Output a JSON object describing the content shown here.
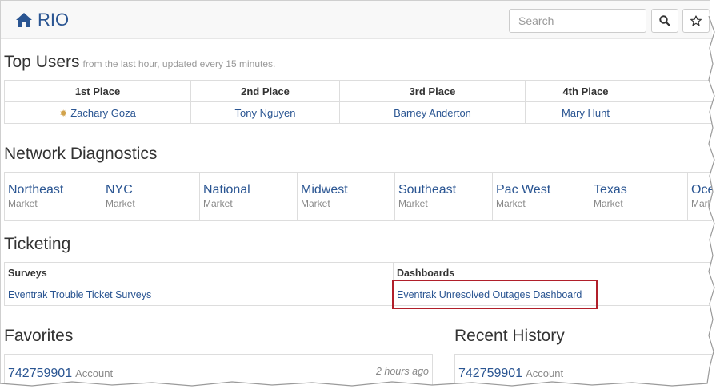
{
  "navbar": {
    "brand": "RIO",
    "search_placeholder": "Search"
  },
  "top_users": {
    "title": "Top Users",
    "subtitle": "from the last hour, updated every 15 minutes.",
    "columns": [
      "1st Place",
      "2nd Place",
      "3rd Place",
      "4th Place"
    ],
    "users": [
      "Zachary Goza",
      "Tony Nguyen",
      "Barney Anderton",
      "Mary Hunt"
    ]
  },
  "network_diagnostics": {
    "title": "Network Diagnostics",
    "markets": [
      {
        "name": "Northeast",
        "type": "Market"
      },
      {
        "name": "NYC",
        "type": "Market"
      },
      {
        "name": "National",
        "type": "Market"
      },
      {
        "name": "Midwest",
        "type": "Market"
      },
      {
        "name": "Southeast",
        "type": "Market"
      },
      {
        "name": "Pac West",
        "type": "Market"
      },
      {
        "name": "Texas",
        "type": "Market"
      },
      {
        "name": "Oce",
        "type": "Mark"
      }
    ]
  },
  "ticketing": {
    "title": "Ticketing",
    "surveys_header": "Surveys",
    "dashboards_header": "Dashboards",
    "survey_link": "Eventrak Trouble Ticket Surveys",
    "dashboard_link": "Eventrak Unresolved Outages Dashboard"
  },
  "favorites": {
    "title": "Favorites",
    "entry_value": "742759901",
    "entry_type": "Account",
    "entry_time": "2 hours ago"
  },
  "recent_history": {
    "title": "Recent History",
    "entry_value": "742759901",
    "entry_type": "Account"
  },
  "colors": {
    "link": "#2a5592",
    "highlight": "#b11f2a"
  }
}
